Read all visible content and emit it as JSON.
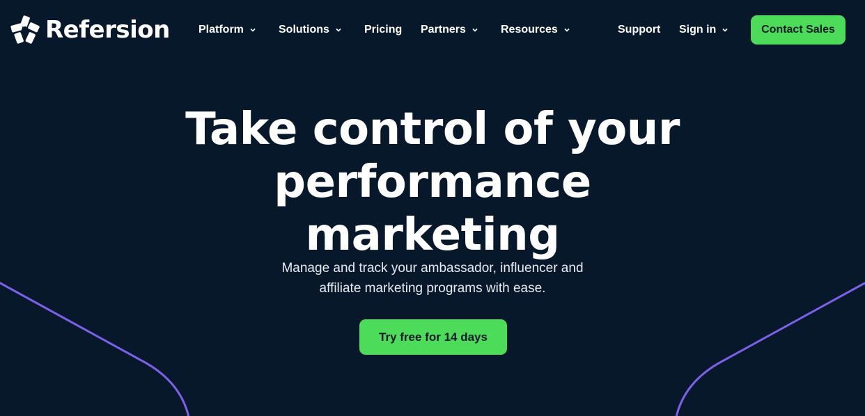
{
  "brand": {
    "name": "Refersion",
    "logo_icon": "refersion-logo-icon"
  },
  "nav": {
    "items": [
      {
        "label": "Platform",
        "has_dropdown": true
      },
      {
        "label": "Solutions",
        "has_dropdown": true
      },
      {
        "label": "Pricing",
        "has_dropdown": false
      },
      {
        "label": "Partners",
        "has_dropdown": true
      },
      {
        "label": "Resources",
        "has_dropdown": true
      }
    ],
    "support_label": "Support",
    "signin_label": "Sign in",
    "contact_label": "Contact Sales"
  },
  "hero": {
    "title_lines": [
      "Take control of your",
      "performance",
      "marketing"
    ],
    "subtitle_lines": [
      "Manage and track your ambassador, influencer and",
      "affiliate marketing programs with ease."
    ],
    "cta_label": "Try free for 14 days"
  },
  "colors": {
    "background": "#07182b",
    "accent_green": "#4cdc5a",
    "decor_purple": "#7b61e8",
    "text": "#ffffff"
  }
}
